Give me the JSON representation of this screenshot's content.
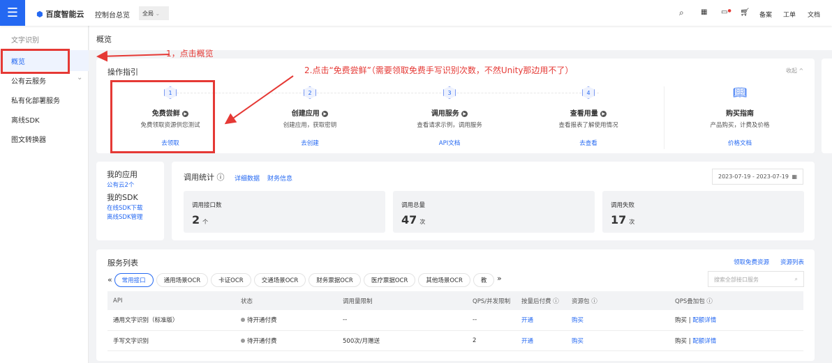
{
  "topbar": {
    "logo": "百度智能云",
    "console": "控制台总览",
    "region": "全局",
    "links": [
      "备案",
      "工单",
      "文档"
    ]
  },
  "sidebar": {
    "title": "文字识别",
    "items": [
      "概览",
      "公有云服务",
      "私有化部署服务",
      "离线SDK",
      "图文转换器"
    ]
  },
  "breadcrumb": "概览",
  "guide": {
    "title": "操作指引",
    "collapse": "收起",
    "steps": [
      {
        "num": "1",
        "title": "免费尝鲜",
        "desc": "免费领取资源供您测试",
        "link": "去领取"
      },
      {
        "num": "2",
        "title": "创建应用",
        "desc": "创建应用，获取密钥",
        "link": "去创建"
      },
      {
        "num": "3",
        "title": "调用服务",
        "desc": "查看请求示例，调用服务",
        "link": "API文档"
      },
      {
        "num": "4",
        "title": "查看用量",
        "desc": "查看报表了解使用情况",
        "link": "去查看"
      }
    ],
    "buy": {
      "title": "购买指南",
      "desc": "产品购买，计费及价格",
      "link": "价格文档"
    }
  },
  "apps": {
    "title": "我的应用",
    "public": "公有云",
    "count": "2个",
    "sdk_title": "我的SDK",
    "sdk_links": [
      "在线SDK下载",
      "离线SDK管理"
    ]
  },
  "stats": {
    "title": "调用统计",
    "links": [
      "详细数据",
      "财务信息"
    ],
    "date": "2023-07-19 - 2023-07-19",
    "cards": [
      {
        "label": "调用接口数",
        "value": "2",
        "unit": "个"
      },
      {
        "label": "调用总量",
        "value": "47",
        "unit": "次"
      },
      {
        "label": "调用失败",
        "value": "17",
        "unit": "次"
      }
    ]
  },
  "services": {
    "title": "服务列表",
    "links": [
      "领取免费资源",
      "资源列表"
    ],
    "tabs": [
      "常用接口",
      "通用场景OCR",
      "卡证OCR",
      "交通场景OCR",
      "财务票据OCR",
      "医疗票据OCR",
      "其他场景OCR",
      "教"
    ],
    "search_placeholder": "搜索全部接口服务",
    "columns": [
      "API",
      "状态",
      "调用量限制",
      "QPS/并发限制",
      "按量后付费",
      "资源包",
      "QPS叠加包"
    ],
    "rows": [
      {
        "api": "通用文字识别（标准版）",
        "status": "待开通付费",
        "limit": "--",
        "qps": "--",
        "pay": "开通",
        "pack": "购买",
        "qps_buy": "购买",
        "qps_detail": "配额详情"
      },
      {
        "api": "手写文字识别",
        "status": "待开通付费",
        "limit": "500次/月赠送",
        "qps": "2",
        "pay": "开通",
        "pack": "购买",
        "qps_buy": "购买",
        "qps_detail": "配额详情"
      }
    ]
  },
  "annotations": {
    "a1": "1，点击概览",
    "a2": "2.点击“免费尝鲜”（需要领取免费手写识别次数，不然Unity那边用不了）"
  }
}
